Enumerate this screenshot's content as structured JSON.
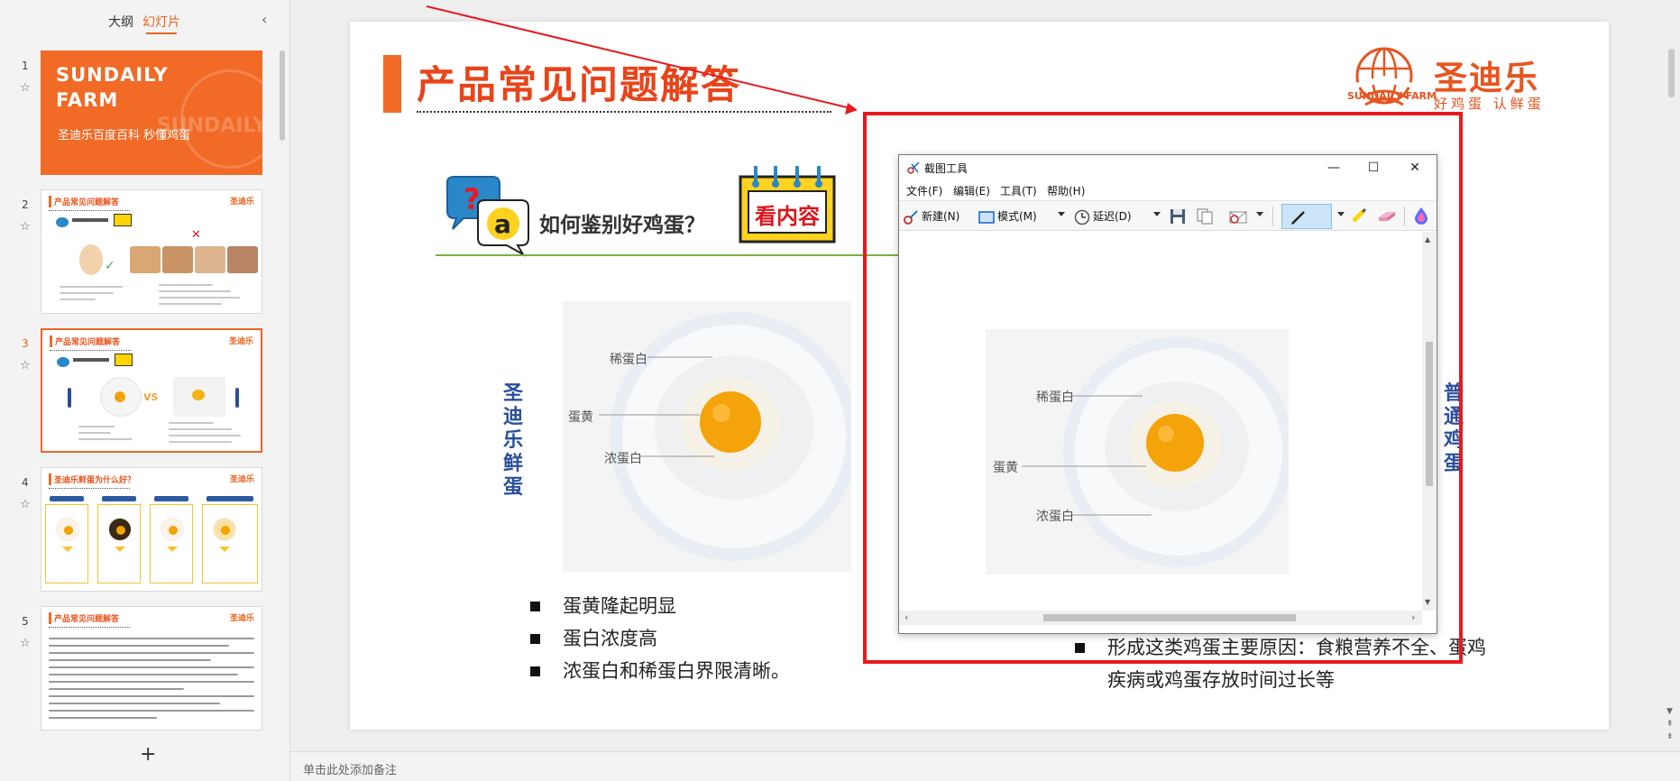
{
  "left_panel": {
    "tab_outline": "大纲",
    "tab_slides": "幻灯片",
    "collapse_icon": "chevron-left-icon",
    "add_slide": "+",
    "thumbnails": [
      {
        "num": "1",
        "title_line1": "SUNDAILY",
        "title_line2": "FARM",
        "subtitle": "圣迪乐百度百科 秒懂鸡蛋",
        "ghost": "SUNDAILY"
      },
      {
        "num": "2",
        "title": "产品常见问题解答",
        "logo": "圣迪乐"
      },
      {
        "num": "3",
        "title": "产品常见问题解答",
        "logo": "圣迪乐",
        "active": true,
        "vs": "VS"
      },
      {
        "num": "4",
        "title": "圣迪乐鲜蛋为什么好？",
        "logo": "圣迪乐"
      },
      {
        "num": "5",
        "title": "产品常见问题解答",
        "logo": "圣迪乐"
      }
    ]
  },
  "slide": {
    "title": "产品常见问题解答",
    "brand": {
      "name_cn": "圣迪乐",
      "name_en": "SUNDAILY FARM",
      "slogan": "好鸡蛋  认鲜蛋"
    },
    "question": "如何鉴别好鸡蛋？",
    "badge": "看内容",
    "left_label": "圣迪乐鲜蛋",
    "right_label": "普通鸡蛋",
    "egg_labels": {
      "thin_white": "稀蛋白",
      "yolk": "蛋黄",
      "thick_white": "浓蛋白"
    },
    "bullets_left": [
      "蛋黄隆起明显",
      "蛋白浓度高",
      "浓蛋白和稀蛋白界限清晰。"
    ],
    "bullets_right": [
      "形成这类鸡蛋主要原因：食粮营养不全、蛋鸡疾病或鸡蛋存放时间过长等"
    ],
    "partial_text": "限。"
  },
  "snipping_tool": {
    "title": "截图工具",
    "menu": [
      "文件(F)",
      "编辑(E)",
      "工具(T)",
      "帮助(H)"
    ],
    "toolbar": {
      "new": "新建(N)",
      "mode": "模式(M)",
      "delay": "延迟(D)"
    },
    "window_buttons": {
      "minimize": "—",
      "maximize": "☐",
      "close": "✕"
    },
    "egg_labels": {
      "thin_white": "稀蛋白",
      "yolk": "蛋黄",
      "thick_white": "浓蛋白"
    }
  },
  "notes": {
    "placeholder": "单击此处添加备注"
  },
  "colors": {
    "accent": "#e8641f",
    "title_red": "#e8441a",
    "annotation_red": "#e8191e",
    "label_blue": "#2a4f9a",
    "green_line": "#7bb03f"
  }
}
